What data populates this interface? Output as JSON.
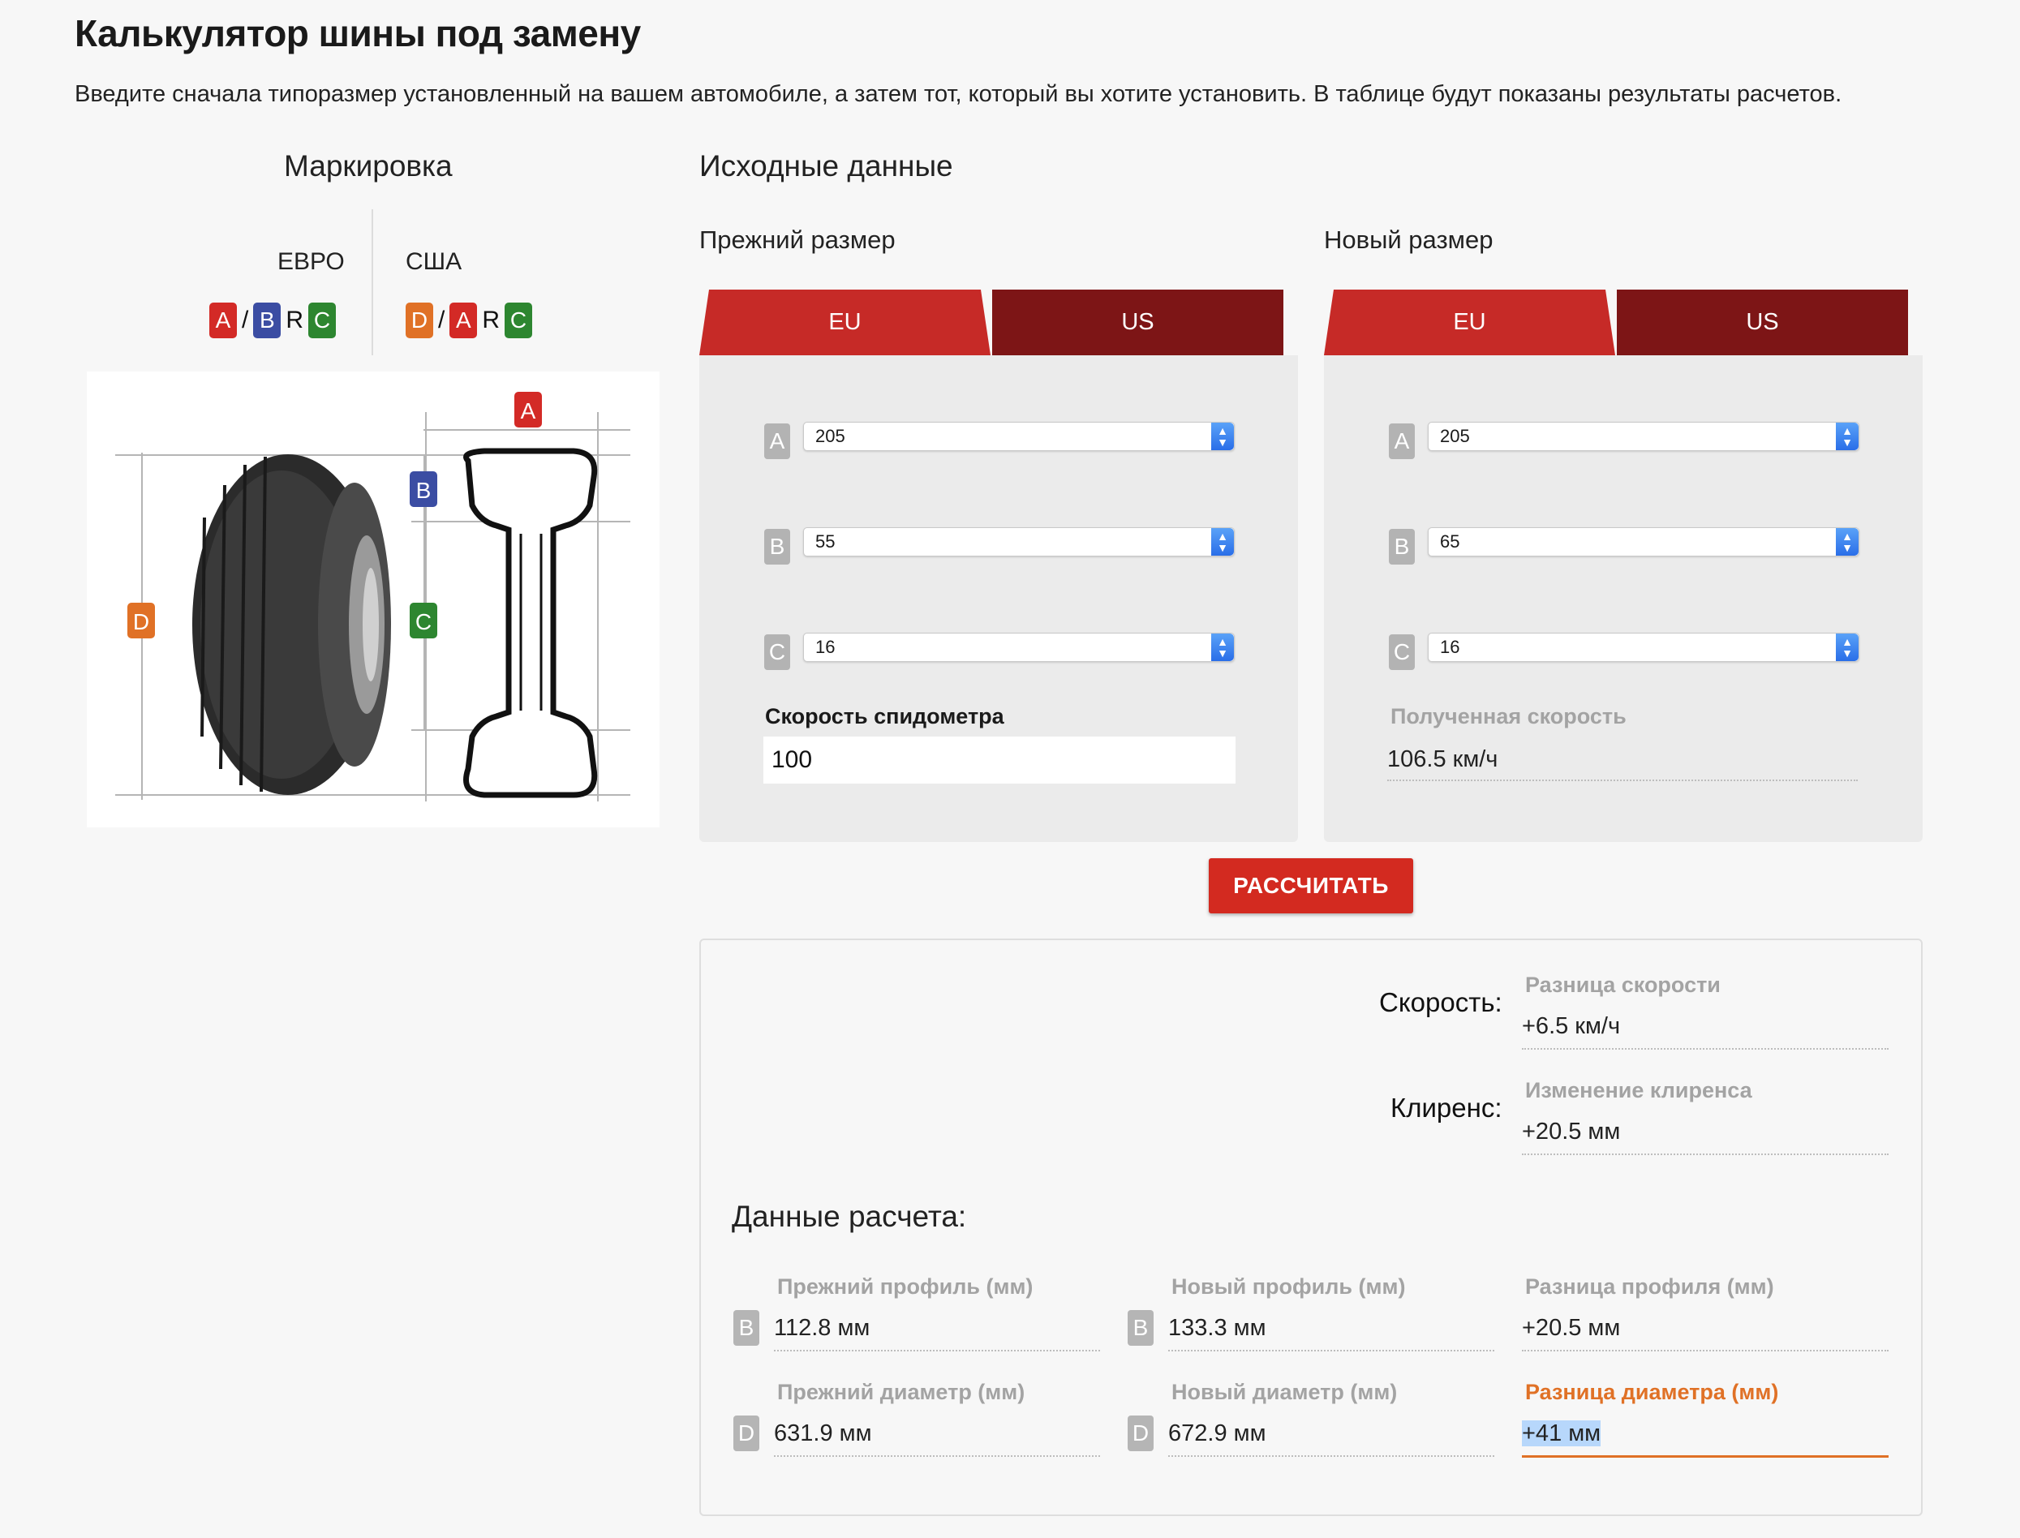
{
  "page": {
    "title": "Калькулятор шины под замену",
    "subtitle": "Введите сначала типоразмер установленный на вашем автомобиле, а затем тот, который вы хотите установить. В таблице будут показаны результаты расчетов."
  },
  "marking": {
    "heading": "Маркировка",
    "euro_label": "ЕВРО",
    "usa_label": "США",
    "euro_code": [
      "A",
      "/",
      "B",
      "R",
      "C"
    ],
    "usa_code": [
      "D",
      "/",
      "A",
      "R",
      "C"
    ],
    "diagram_labels": {
      "a": "A",
      "b": "B",
      "c": "C",
      "d": "D"
    }
  },
  "inputs": {
    "heading": "Исходные данные",
    "old_size": {
      "heading": "Прежний размер",
      "tabs": [
        "EU",
        "US"
      ],
      "fields": [
        {
          "badge": "A",
          "value": "205"
        },
        {
          "badge": "B",
          "value": "55"
        },
        {
          "badge": "C",
          "value": "16"
        }
      ],
      "speed_label": "Скорость спидометра",
      "speed_value": "100"
    },
    "new_size": {
      "heading": "Новый размер",
      "tabs": [
        "EU",
        "US"
      ],
      "fields": [
        {
          "badge": "A",
          "value": "205"
        },
        {
          "badge": "B",
          "value": "65"
        },
        {
          "badge": "C",
          "value": "16"
        }
      ],
      "result_speed_label": "Полученная скорость",
      "result_speed_value": "106.5 км/ч"
    },
    "calculate_label": "РАССЧИТАТЬ"
  },
  "results": {
    "speed_label": "Скорость:",
    "speed_diff_label": "Разница скорости",
    "speed_diff_value": "+6.5 км/ч",
    "clearance_label": "Клиренс:",
    "clearance_diff_label": "Изменение клиренса",
    "clearance_diff_value": "+20.5 мм",
    "data_title": "Данные расчета:",
    "rows": [
      {
        "badge": "B",
        "old_label": "Прежний профиль (мм)",
        "old_value": "112.8 мм",
        "new_label": "Новый профиль (мм)",
        "new_value": "133.3 мм",
        "diff_label": "Разница профиля (мм)",
        "diff_value": "+20.5 мм"
      },
      {
        "badge": "D",
        "old_label": "Прежний диаметр (мм)",
        "old_value": "631.9 мм",
        "new_label": "Новый диаметр (мм)",
        "new_value": "672.9 мм",
        "diff_label": "Разница диаметра (мм)",
        "diff_value": "+41 мм"
      }
    ]
  },
  "colors": {
    "tab_active": "#c62a27",
    "tab_inactive": "#7d1516",
    "button": "#d32a20",
    "accent_orange": "#e07126",
    "badge_a": "#d32a26",
    "badge_b": "#3b4da3",
    "badge_c": "#2d8630",
    "badge_d": "#e07126"
  }
}
